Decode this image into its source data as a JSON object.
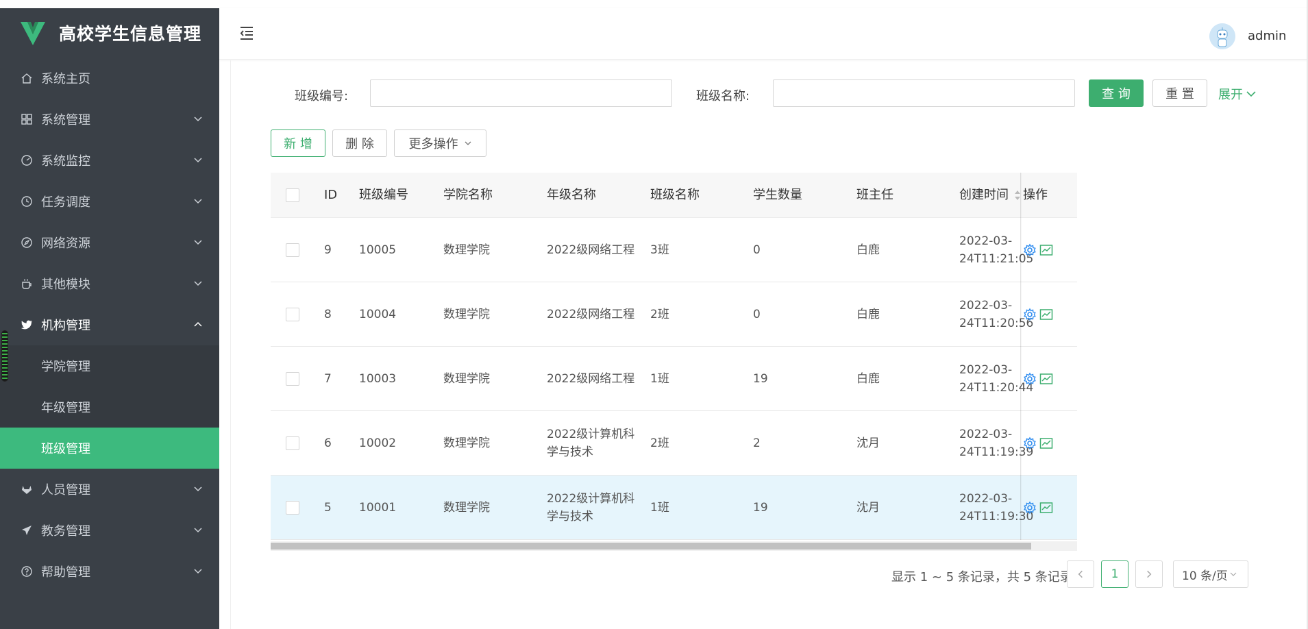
{
  "app": {
    "title": "高校学生信息管理",
    "accent": "#3dba7e",
    "sidebar_bg": "#3a4047"
  },
  "sidebar": {
    "items": [
      {
        "label": "系统主页",
        "icon": "home-icon",
        "has_children": false
      },
      {
        "label": "系统管理",
        "icon": "grid-icon",
        "has_children": true
      },
      {
        "label": "系统监控",
        "icon": "dashboard-icon",
        "has_children": true
      },
      {
        "label": "任务调度",
        "icon": "clock-icon",
        "has_children": true
      },
      {
        "label": "网络资源",
        "icon": "compass-icon",
        "has_children": true
      },
      {
        "label": "其他模块",
        "icon": "coffee-icon",
        "has_children": true
      },
      {
        "label": "机构管理",
        "icon": "twitter-icon",
        "has_children": true,
        "open": true
      },
      {
        "label": "人员管理",
        "icon": "gitlab-icon",
        "has_children": true
      },
      {
        "label": "教务管理",
        "icon": "send-icon",
        "has_children": true
      },
      {
        "label": "帮助管理",
        "icon": "question-icon",
        "has_children": true
      }
    ],
    "submenu": [
      {
        "label": "学院管理",
        "active": false
      },
      {
        "label": "年级管理",
        "active": false
      },
      {
        "label": "班级管理",
        "active": true
      }
    ]
  },
  "header": {
    "username": "admin"
  },
  "search": {
    "class_no_label": "班级编号:",
    "class_no_value": "",
    "class_name_label": "班级名称:",
    "class_name_value": "",
    "query_label": "查 询",
    "reset_label": "重 置",
    "expand_label": "展开"
  },
  "toolbar": {
    "add_label": "新 增",
    "delete_label": "删 除",
    "more_label": "更多操作"
  },
  "table": {
    "columns": [
      "ID",
      "班级编号",
      "学院名称",
      "年级名称",
      "班级名称",
      "学生数量",
      "班主任",
      "创建时间",
      "操作"
    ],
    "rows": [
      {
        "id": "9",
        "class_no": "10005",
        "college": "数理学院",
        "grade": "2022级网络工程",
        "class_name": "3班",
        "students": "0",
        "teacher": "白鹿",
        "created_1": "2022-03-",
        "created_2": "24T11:21:05"
      },
      {
        "id": "8",
        "class_no": "10004",
        "college": "数理学院",
        "grade": "2022级网络工程",
        "class_name": "2班",
        "students": "0",
        "teacher": "白鹿",
        "created_1": "2022-03-",
        "created_2": "24T11:20:56"
      },
      {
        "id": "7",
        "class_no": "10003",
        "college": "数理学院",
        "grade": "2022级网络工程",
        "class_name": "1班",
        "students": "19",
        "teacher": "白鹿",
        "created_1": "2022-03-",
        "created_2": "24T11:20:44"
      },
      {
        "id": "6",
        "class_no": "10002",
        "college": "数理学院",
        "grade": "2022级计算机科学与技术",
        "class_name": "2班",
        "students": "2",
        "teacher": "沈月",
        "created_1": "2022-03-",
        "created_2": "24T11:19:39"
      },
      {
        "id": "5",
        "class_no": "10001",
        "college": "数理学院",
        "grade": "2022级计算机科学与技术",
        "class_name": "1班",
        "students": "19",
        "teacher": "沈月",
        "created_1": "2022-03-",
        "created_2": "24T11:19:30"
      }
    ]
  },
  "pagination": {
    "summary": "显示 1 ~ 5 条记录，共 5 条记录",
    "current": "1",
    "page_size": "10 条/页"
  }
}
